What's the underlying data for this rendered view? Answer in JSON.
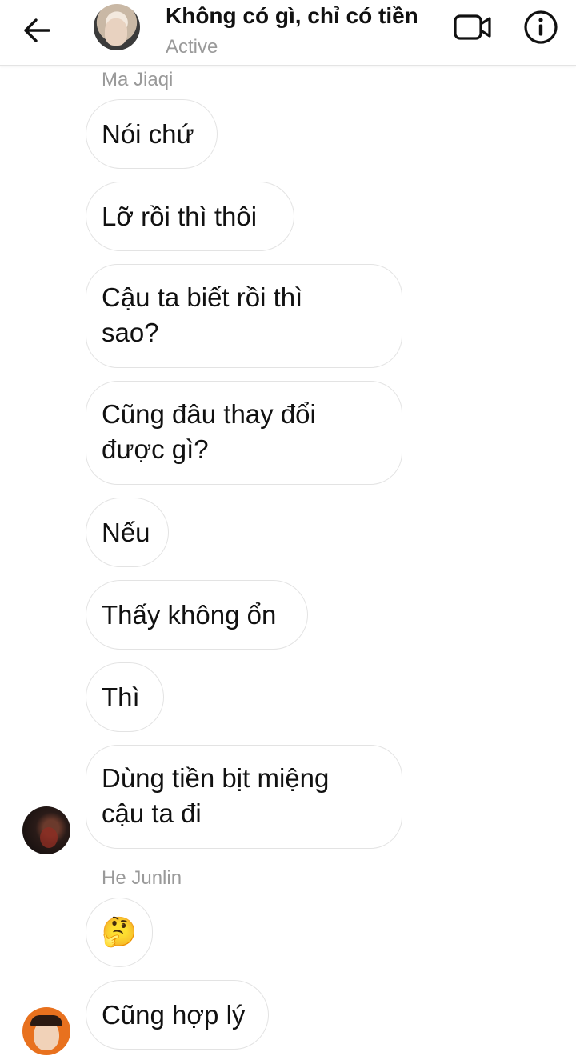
{
  "header": {
    "title": "Không có gì, chỉ có tiền",
    "status": "Active",
    "back_icon": "arrow-left-icon",
    "video_icon": "video-camera-icon",
    "info_icon": "info-icon"
  },
  "colors": {
    "text": "#111111",
    "muted": "#9a9a9a",
    "bubble_border": "#e3e3e3",
    "background": "#ffffff"
  },
  "groups": [
    {
      "sender": "Ma Jiaqi",
      "messages": [
        "Nói chứ",
        "Lỡ rồi thì thôi",
        "Cậu ta biết rồi thì sao?",
        "Cũng đâu thay đổi được gì?",
        "Nếu",
        "Thấy không ổn",
        "Thì",
        "Dùng tiền bịt miệng cậu ta đi"
      ]
    },
    {
      "sender": "He Junlin",
      "messages": [
        "🤔",
        "Cũng hợp lý"
      ]
    }
  ]
}
